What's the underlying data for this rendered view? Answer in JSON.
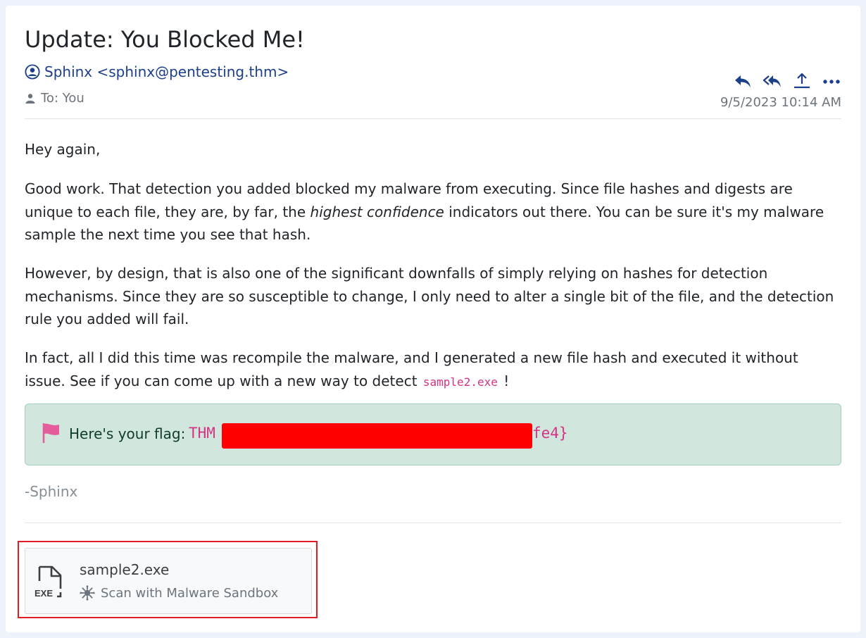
{
  "email": {
    "subject": "Update: You Blocked Me!",
    "sender": "Sphinx <sphinx@pentesting.thm>",
    "recipient": "To: You",
    "date": "9/5/2023 10:14 AM",
    "actions": [
      {
        "name": "reply-icon"
      },
      {
        "name": "reply-all-icon"
      },
      {
        "name": "forward-icon"
      },
      {
        "name": "more-icon"
      }
    ],
    "body": {
      "greeting": "Hey again,",
      "p2_a": "Good work. That detection you added blocked my malware from executing. Since file hashes and digests are unique to each file, they are, by far, the ",
      "p2_em": "highest confidence",
      "p2_b": " indicators out there. You can be sure it's my malware sample the next time you see that hash.",
      "p3": "However, by design, that is also one of the significant downfalls of simply relying on hashes for detection mechanisms. Since they are so susceptible to change, I only need to alter a single bit of the file, and the detection rule you added will fail.",
      "p4_a": "In fact, all I did this time was recompile the malware, and I generated a new file hash and executed it without issue. See if you can come up with a new way to detect ",
      "p4_code": "sample2.exe",
      "p4_b": " !"
    },
    "flag": {
      "label": "Here's your flag:",
      "prefix": "THM",
      "suffix": "fe4}",
      "redaction_color": "#ff0000"
    },
    "signature": "-Sphinx",
    "attachment": {
      "filename": "sample2.exe",
      "file_type_label": "EXE",
      "scan_label": "Scan with Malware Sandbox"
    }
  },
  "colors": {
    "accent": "#1c3f8a",
    "flag_bg": "#d1e7dd",
    "code": "#d63384",
    "highlight_border": "#e31b23"
  }
}
